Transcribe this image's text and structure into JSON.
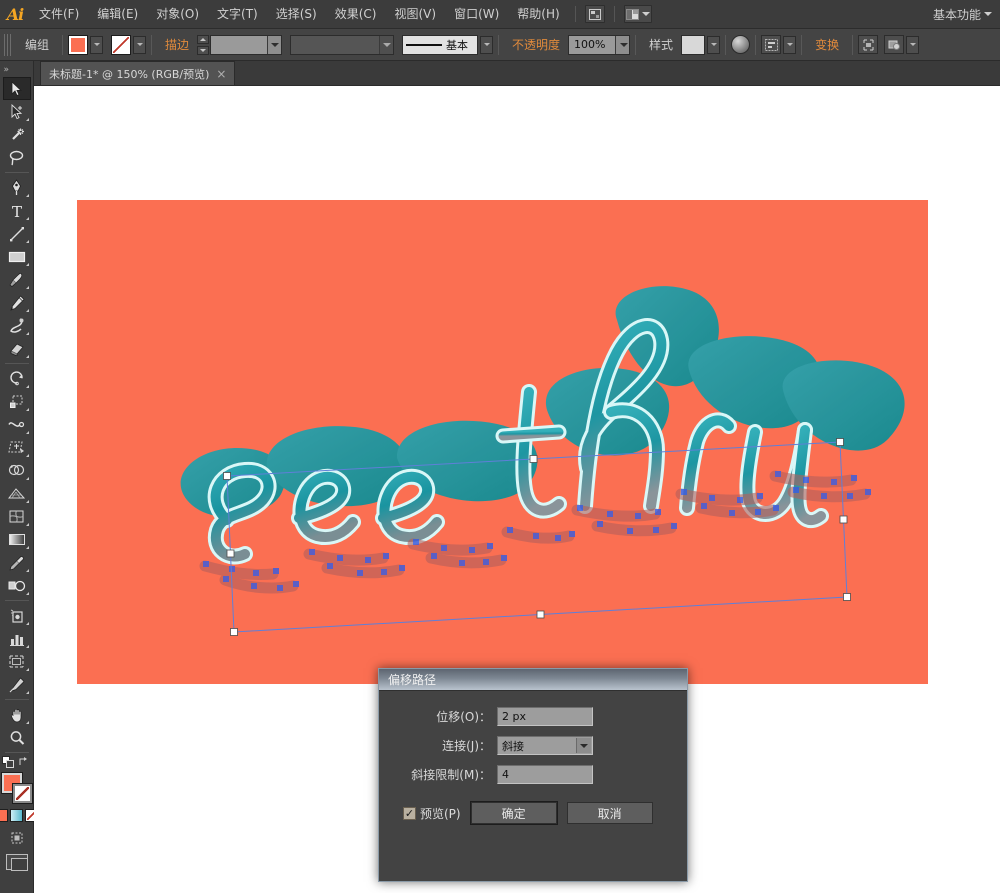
{
  "app": {
    "logo": "Ai",
    "workspace": "基本功能"
  },
  "menubar": {
    "items": [
      {
        "label": "文件(F)",
        "name": "menu-file"
      },
      {
        "label": "编辑(E)",
        "name": "menu-edit"
      },
      {
        "label": "对象(O)",
        "name": "menu-object"
      },
      {
        "label": "文字(T)",
        "name": "menu-type"
      },
      {
        "label": "选择(S)",
        "name": "menu-select"
      },
      {
        "label": "效果(C)",
        "name": "menu-effect"
      },
      {
        "label": "视图(V)",
        "name": "menu-view"
      },
      {
        "label": "窗口(W)",
        "name": "menu-window"
      },
      {
        "label": "帮助(H)",
        "name": "menu-help"
      }
    ]
  },
  "controlbar": {
    "selection_label": "编组",
    "fill_color": "#fb6f52",
    "stroke_label": "描边",
    "stroke_weight": "",
    "stroke_profile": "",
    "brush_label": "基本",
    "opacity_label": "不透明度",
    "opacity_value": "100%",
    "style_label": "样式",
    "transform_label": "变换"
  },
  "tabbar": {
    "document_tab": "未标题-1* @ 150% (RGB/预览)",
    "close": "×"
  },
  "toolbar": {
    "tools": [
      {
        "name": "selection-tool",
        "label": "选择工具",
        "active": true
      },
      {
        "name": "direct-selection-tool",
        "label": "直接选择工具"
      },
      {
        "name": "magic-wand-tool",
        "label": "魔棒工具"
      },
      {
        "name": "lasso-tool",
        "label": "套索工具"
      },
      {
        "name": "pen-tool",
        "label": "钢笔工具"
      },
      {
        "name": "type-tool",
        "label": "文字工具"
      },
      {
        "name": "line-segment-tool",
        "label": "直线段工具"
      },
      {
        "name": "rectangle-tool",
        "label": "矩形工具"
      },
      {
        "name": "paintbrush-tool",
        "label": "画笔工具"
      },
      {
        "name": "pencil-tool",
        "label": "铅笔工具"
      },
      {
        "name": "blob-brush-tool",
        "label": "斑点画笔工具"
      },
      {
        "name": "eraser-tool",
        "label": "橡皮擦工具"
      },
      {
        "name": "rotate-tool",
        "label": "旋转工具"
      },
      {
        "name": "scale-tool",
        "label": "比例缩放工具"
      },
      {
        "name": "width-tool",
        "label": "宽度工具"
      },
      {
        "name": "free-transform-tool",
        "label": "自由变换工具"
      },
      {
        "name": "shape-builder-tool",
        "label": "形状生成器工具"
      },
      {
        "name": "perspective-grid-tool",
        "label": "透视网格工具"
      },
      {
        "name": "mesh-tool",
        "label": "网格工具"
      },
      {
        "name": "gradient-tool",
        "label": "渐变工具"
      },
      {
        "name": "eyedropper-tool",
        "label": "吸管工具"
      },
      {
        "name": "blend-tool",
        "label": "混合工具"
      },
      {
        "name": "symbol-sprayer-tool",
        "label": "符号喷枪工具"
      },
      {
        "name": "column-graph-tool",
        "label": "柱形图工具"
      },
      {
        "name": "artboard-tool",
        "label": "画板工具"
      },
      {
        "name": "slice-tool",
        "label": "切片工具"
      },
      {
        "name": "hand-tool",
        "label": "抓手工具"
      },
      {
        "name": "zoom-tool",
        "label": "缩放工具"
      }
    ],
    "fill_color": "#fb6f52",
    "stroke_color": "none",
    "color_modes": [
      {
        "name": "color-mode",
        "color": "#fb6f52"
      },
      {
        "name": "gradient-mode",
        "color": "#8fd0dd"
      },
      {
        "name": "none-mode",
        "color": "#ffffff"
      }
    ]
  },
  "canvas": {
    "background": "#ffffff",
    "artboard_color": "#fb6f52",
    "artwork_text_1": "see",
    "artwork_text_2": "thru",
    "letter_face_color": "#1f9aa8",
    "letter_outline_color": "#c9f2f2",
    "extrude_color": "#0e8a8a",
    "selection_color": "#5f7fd8",
    "anchor_color": "#3355dd"
  },
  "dialog": {
    "title": "偏移路径",
    "offset_label": "位移(O)：",
    "offset_value": "2 px",
    "join_label": "连接(J)：",
    "join_value": "斜接",
    "miter_label": "斜接限制(M)：",
    "miter_value": "4",
    "preview_label": "预览(P)",
    "preview_checked": "✓",
    "ok_label": "确定",
    "cancel_label": "取消"
  }
}
